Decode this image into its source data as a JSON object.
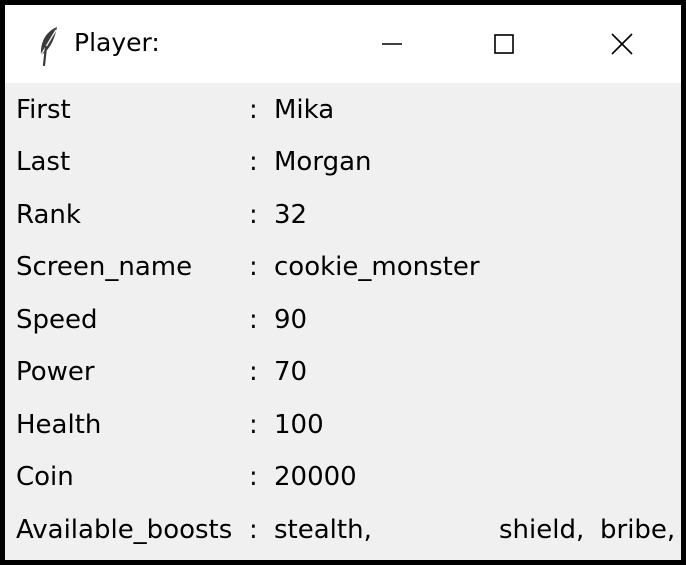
{
  "window": {
    "title": "Player:",
    "icon": "feather-icon",
    "controls": [
      "minimize-icon",
      "maximize-icon",
      "close-icon"
    ]
  },
  "separator": ":",
  "fields": [
    {
      "label": "First",
      "value": "Mika"
    },
    {
      "label": "Last",
      "value": "Morgan"
    },
    {
      "label": "Rank",
      "value": "32"
    },
    {
      "label": "Screen_name",
      "value": "cookie_monster"
    },
    {
      "label": "Speed",
      "value": "90"
    },
    {
      "label": "Power",
      "value": "70"
    },
    {
      "label": "Health",
      "value": "100"
    },
    {
      "label": "Coin",
      "value": "20000"
    }
  ],
  "boosts": {
    "label": "Available_boosts",
    "values": [
      "stealth,",
      "shield,",
      "bribe,"
    ]
  }
}
